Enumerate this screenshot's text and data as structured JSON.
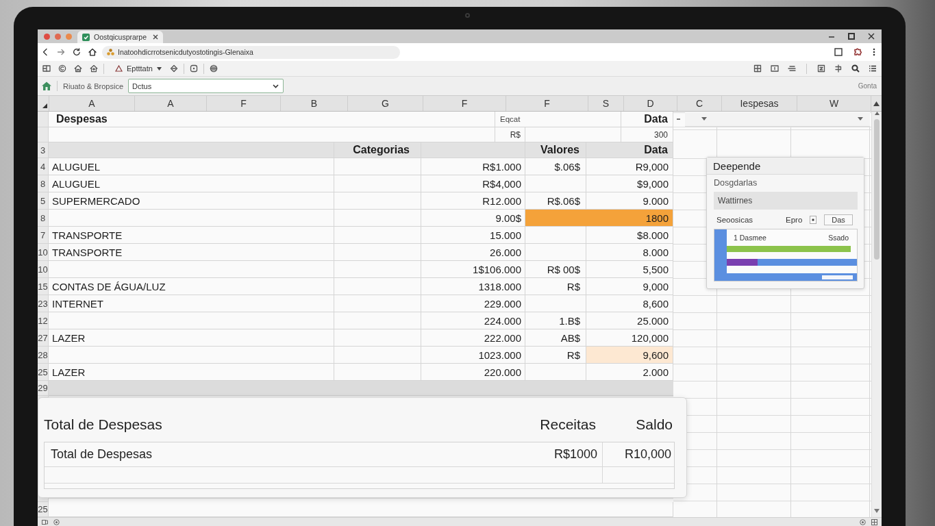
{
  "browser": {
    "tab_title": "Oostqicusprarpe",
    "url": "Inatoohdicrrotsenicdutyostotingis-Glenaixa"
  },
  "toolbar": {
    "style_menu": "Eptttatn"
  },
  "formula_bar": {
    "name_label": "Riuato & Bropsice",
    "combo_value": "Dctus",
    "right_label": "Gonta"
  },
  "sheet": {
    "column_headers": [
      "A",
      "A",
      "F",
      "B",
      "G",
      "F",
      "F",
      "S",
      "D",
      "C",
      "Iespesas",
      "W"
    ],
    "title": "Despesas",
    "row_1": {
      "label": "Eqcat",
      "column_title": "Data"
    },
    "row_2": {
      "currency": "R$",
      "value": "300"
    },
    "header_row": {
      "number": "3",
      "categories": "Categorias",
      "values": "Valores",
      "date": "Data"
    },
    "rows": [
      {
        "number": "4",
        "category": "ALUGUEL",
        "amount": "R$1.000",
        "note": "$.06$",
        "date": "R9,000",
        "highlighted": false,
        "tinted": false
      },
      {
        "number": "8",
        "category": "ALUGUEL",
        "amount": "R$4,000",
        "date": "$9,000",
        "highlighted": false,
        "tinted": false
      },
      {
        "number": "5",
        "category": "SUPERMERCADO",
        "amount": "R12.000",
        "note": "R$.06$",
        "date": "9.000",
        "highlighted": false,
        "tinted": false
      },
      {
        "number": "8",
        "amount": "9.00$",
        "date": "1800",
        "highlighted": true,
        "tinted": false
      },
      {
        "number": "7",
        "category": "TRANSPORTE",
        "amount": "15.000",
        "date": "$8.000",
        "highlighted": false,
        "tinted": false
      },
      {
        "number": "10",
        "category": "TRANSPORTE",
        "amount": "26.000",
        "date": "8.000",
        "highlighted": false,
        "tinted": false
      },
      {
        "number": "10",
        "amount": "1$106.000",
        "note": "R$ 00$",
        "date": "5,500",
        "highlighted": false,
        "tinted": false
      },
      {
        "number": "15",
        "category": "CONTAS DE ÁGUA/LUZ",
        "amount": "1318.000",
        "note": "R$",
        "date": "9,000",
        "highlighted": false,
        "tinted": false
      },
      {
        "number": "23",
        "category": "INTERNET",
        "amount": "229.000",
        "date": "8,600",
        "highlighted": false,
        "tinted": false
      },
      {
        "number": "12",
        "amount": "224.000",
        "note": "1.B$",
        "date": "25.000",
        "highlighted": false,
        "tinted": false
      },
      {
        "number": "27",
        "category": "LAZER",
        "amount": "222.000",
        "note": "AB$",
        "date": "120,000",
        "highlighted": false,
        "tinted": false
      },
      {
        "number": "28",
        "amount": "1023.000",
        "note": "R$",
        "date": "9,600",
        "highlighted": false,
        "tinted": true
      },
      {
        "number": "25",
        "category": "LAZER",
        "amount": "220.000",
        "date": "2.000",
        "highlighted": false,
        "tinted": false
      }
    ],
    "band_row": {
      "number": "29"
    },
    "last_row": {
      "number": "25"
    }
  },
  "side_panel": {
    "title": "Deepende",
    "subtitle": "Dosgdarlas",
    "field_value": "Wattirnes",
    "option_label": "Seoosicas",
    "checkbox_label": "Epro",
    "checked": true,
    "button": "Das",
    "chart_labels": [
      "1 Dasmee",
      "Ssado"
    ]
  },
  "summary": {
    "title": "Total de Despesas",
    "income_heading": "Receitas",
    "balance_heading": "Saldo",
    "rows": [
      {
        "label": "Total de Despesas",
        "income": "R$1000",
        "balance": "R10,000"
      }
    ]
  }
}
